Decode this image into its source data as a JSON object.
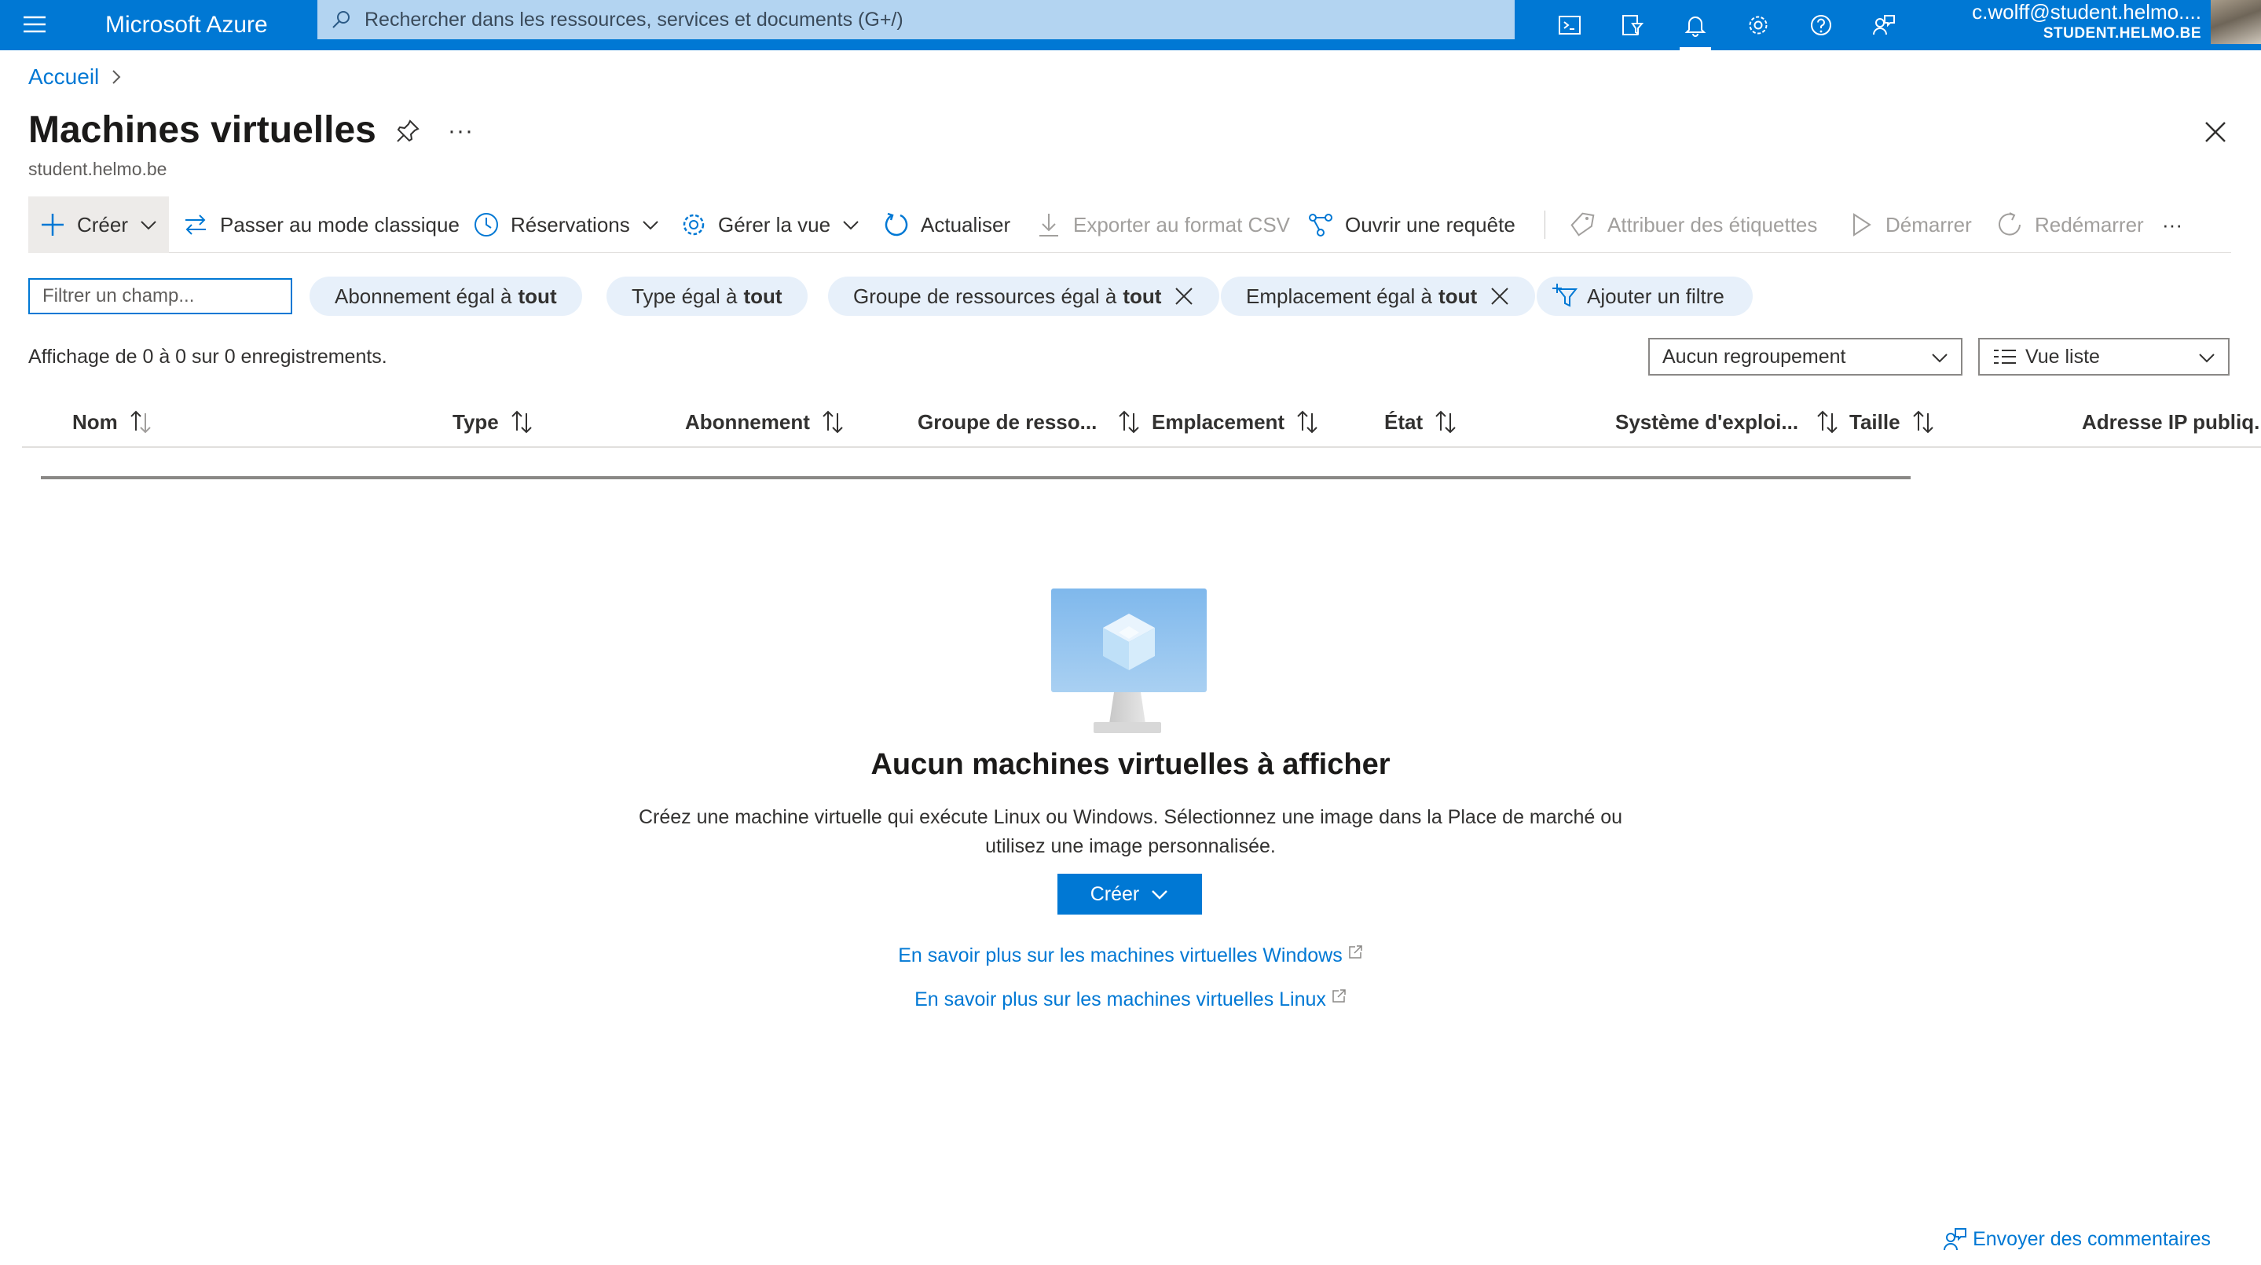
{
  "topbar": {
    "brand": "Microsoft Azure",
    "search_placeholder": "Rechercher dans les ressources, services et documents (G+/)",
    "user_email": "c.wolff@student.helmo....",
    "user_tenant": "STUDENT.HELMO.BE",
    "icons": [
      "menu-icon",
      "cloud-shell-icon",
      "directory-filter-icon",
      "notifications-icon",
      "settings-icon",
      "help-icon",
      "feedback-icon"
    ]
  },
  "breadcrumb": {
    "home": "Accueil"
  },
  "header": {
    "title": "Machines virtuelles",
    "subtitle": "student.helmo.be",
    "more": "···"
  },
  "commands": {
    "create": "Créer",
    "classic": "Passer au mode classique",
    "reservations": "Réservations",
    "manage_view": "Gérer la vue",
    "refresh": "Actualiser",
    "export_csv": "Exporter au format CSV",
    "open_query": "Ouvrir une requête",
    "assign_tags": "Attribuer des étiquettes",
    "start": "Démarrer",
    "restart": "Redémarrer",
    "more": "···"
  },
  "filters": {
    "placeholder": "Filtrer un champ...",
    "pills": [
      {
        "label": "Abonnement égal à",
        "value": "tout"
      },
      {
        "label": "Type égal à",
        "value": "tout"
      },
      {
        "label": "Groupe de ressources égal à",
        "value": "tout"
      },
      {
        "label": "Emplacement égal à",
        "value": "tout"
      }
    ],
    "add_filter": "Ajouter un filtre"
  },
  "list": {
    "record_count": "Affichage de 0 à 0 sur 0 enregistrements.",
    "grouping": "Aucun regroupement",
    "view": "Vue liste",
    "columns": [
      "Nom",
      "Type",
      "Abonnement",
      "Groupe de resso...",
      "Emplacement",
      "État",
      "Système d'exploi...",
      "Taille",
      "Adresse IP publiq..."
    ]
  },
  "empty_state": {
    "title": "Aucun machines virtuelles à afficher",
    "line1": "Créez une machine virtuelle qui exécute Linux ou Windows. Sélectionnez une image dans la Place de marché ou",
    "line2": "utilisez une image personnalisée.",
    "create": "Créer",
    "link_windows": "En savoir plus sur les machines virtuelles Windows",
    "link_linux": "En savoir plus sur les machines virtuelles Linux"
  },
  "footer": {
    "feedback": "Envoyer des commentaires"
  },
  "colors": {
    "accent": "#0078d4",
    "pill_bg": "#e7f0fa",
    "search_bg": "#b3d4f1"
  }
}
